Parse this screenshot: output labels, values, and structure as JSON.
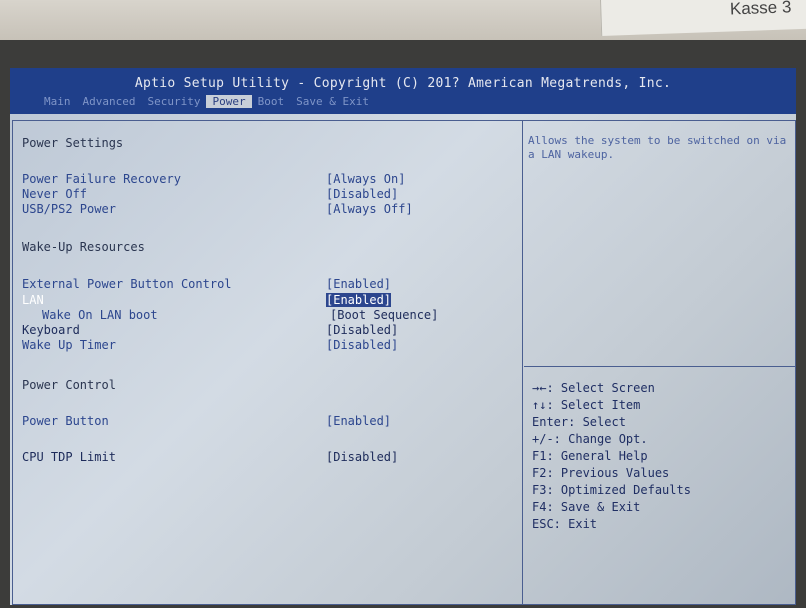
{
  "sticker": {
    "label": "Kasse 3"
  },
  "header": {
    "title": "Aptio Setup Utility - Copyright (C) 201? American Megatrends, Inc.",
    "tabs": [
      "Main",
      "Advanced",
      "Security",
      "Power",
      "Boot",
      "Save & Exit"
    ],
    "active_tab": "Power"
  },
  "settings": {
    "section_power": "Power Settings",
    "power_failure_recovery": {
      "label": "Power Failure Recovery",
      "value": "[Always On]"
    },
    "never_off": {
      "label": "Never Off",
      "value": "[Disabled]"
    },
    "usb_ps2_power": {
      "label": "USB/PS2 Power",
      "value": "[Always Off]"
    },
    "section_wake": "Wake-Up Resources",
    "external_power_button": {
      "label": "External Power Button Control",
      "value": "[Enabled]"
    },
    "lan": {
      "label": "LAN",
      "value": "[Enabled]"
    },
    "wake_on_lan_boot": {
      "label": "Wake On LAN boot",
      "value": "[Boot Sequence]"
    },
    "keyboard": {
      "label": "Keyboard",
      "value": "[Disabled]"
    },
    "wake_up_timer": {
      "label": "Wake Up Timer",
      "value": "[Disabled]"
    },
    "section_control": "Power Control",
    "power_button": {
      "label": "Power Button",
      "value": "[Enabled]"
    },
    "cpu_tdp_limit": {
      "label": "CPU TDP Limit",
      "value": "[Disabled]"
    }
  },
  "help": {
    "text": "Allows the system to be switched on via a LAN wakeup."
  },
  "keys": {
    "select_screen": "→←: Select Screen",
    "select_item": "↑↓: Select Item",
    "enter": "Enter: Select",
    "change_opt": "+/-: Change Opt.",
    "f1": "F1: General Help",
    "f2": "F2: Previous Values",
    "f3": "F3: Optimized Defaults",
    "f4": "F4: Save & Exit",
    "esc": "ESC: Exit"
  },
  "colors": {
    "titlebar": "#1f3f8a",
    "item_text": "#2c468e",
    "selection": "#2c468e"
  }
}
